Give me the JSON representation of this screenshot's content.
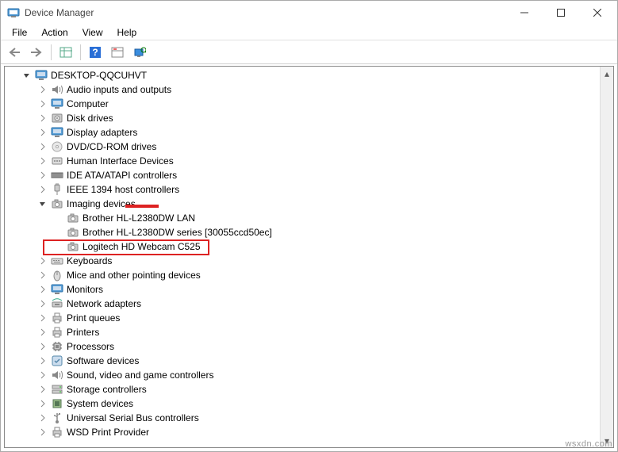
{
  "window": {
    "title": "Device Manager"
  },
  "menu": {
    "file": "File",
    "action": "Action",
    "view": "View",
    "help": "Help"
  },
  "root": {
    "name": "DESKTOP-QQCUHVT"
  },
  "categories": [
    {
      "id": "audio",
      "label": "Audio inputs and outputs",
      "expanded": false,
      "icon": "speaker"
    },
    {
      "id": "computer",
      "label": "Computer",
      "expanded": false,
      "icon": "monitor"
    },
    {
      "id": "disk",
      "label": "Disk drives",
      "expanded": false,
      "icon": "disk"
    },
    {
      "id": "display",
      "label": "Display adapters",
      "expanded": false,
      "icon": "monitor"
    },
    {
      "id": "dvd",
      "label": "DVD/CD-ROM drives",
      "expanded": false,
      "icon": "disc"
    },
    {
      "id": "hid",
      "label": "Human Interface Devices",
      "expanded": false,
      "icon": "hid"
    },
    {
      "id": "ide",
      "label": "IDE ATA/ATAPI controllers",
      "expanded": false,
      "icon": "ide"
    },
    {
      "id": "ieee",
      "label": "IEEE 1394 host controllers",
      "expanded": false,
      "icon": "plug"
    },
    {
      "id": "imaging",
      "label": "Imaging devices",
      "expanded": true,
      "icon": "camera",
      "children": [
        {
          "label": "Brother HL-L2380DW LAN"
        },
        {
          "label": "Brother HL-L2380DW series [30055ccd50ec]"
        },
        {
          "label": "Logitech HD Webcam C525",
          "highlighted": true
        }
      ]
    },
    {
      "id": "keyboards",
      "label": "Keyboards",
      "expanded": false,
      "icon": "keyboard"
    },
    {
      "id": "mice",
      "label": "Mice and other pointing devices",
      "expanded": false,
      "icon": "mouse"
    },
    {
      "id": "monitors",
      "label": "Monitors",
      "expanded": false,
      "icon": "monitor"
    },
    {
      "id": "network",
      "label": "Network adapters",
      "expanded": false,
      "icon": "net"
    },
    {
      "id": "printq",
      "label": "Print queues",
      "expanded": false,
      "icon": "printer"
    },
    {
      "id": "printers",
      "label": "Printers",
      "expanded": false,
      "icon": "printer"
    },
    {
      "id": "proc",
      "label": "Processors",
      "expanded": false,
      "icon": "cpu"
    },
    {
      "id": "software",
      "label": "Software devices",
      "expanded": false,
      "icon": "sw"
    },
    {
      "id": "sound",
      "label": "Sound, video and game controllers",
      "expanded": false,
      "icon": "speaker"
    },
    {
      "id": "storage",
      "label": "Storage controllers",
      "expanded": false,
      "icon": "storage"
    },
    {
      "id": "system",
      "label": "System devices",
      "expanded": false,
      "icon": "chip"
    },
    {
      "id": "usb",
      "label": "Universal Serial Bus controllers",
      "expanded": false,
      "icon": "usb"
    },
    {
      "id": "wsd",
      "label": "WSD Print Provider",
      "expanded": false,
      "icon": "printer"
    }
  ],
  "watermark": "wsxdn.com"
}
